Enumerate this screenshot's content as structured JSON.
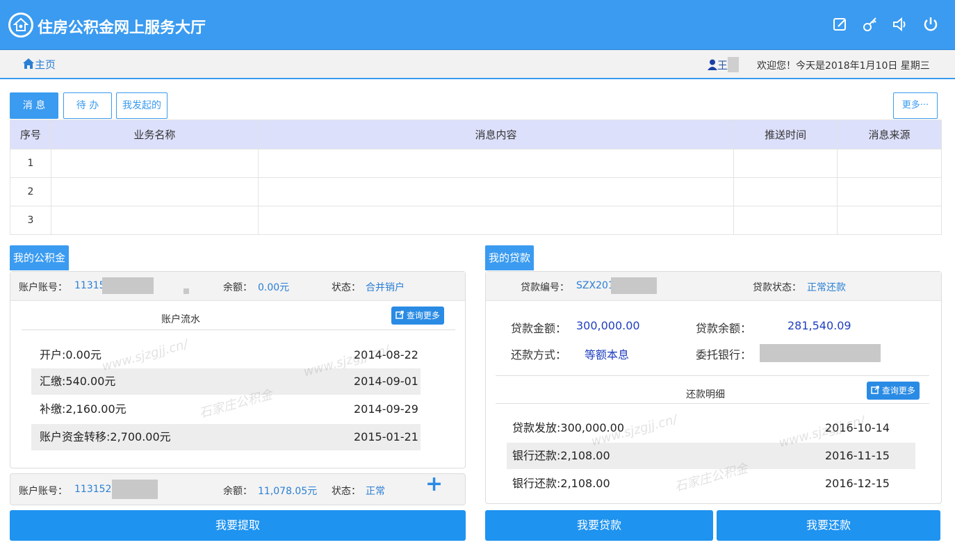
{
  "header": {
    "title": "住房公积金网上服务大厅",
    "icons": [
      "edit-icon",
      "key-icon",
      "speaker-icon",
      "power-icon"
    ]
  },
  "subbar": {
    "home_label": "主页",
    "user_name": "王",
    "welcome": "欢迎您！今天是2018年1月10日 星期三"
  },
  "tabs": [
    {
      "label": "消 息",
      "active": true
    },
    {
      "label": "待 办",
      "active": false
    },
    {
      "label": "我发起的",
      "active": false
    }
  ],
  "more_label": "更多···",
  "table": {
    "headers": [
      "序号",
      "业务名称",
      "消息内容",
      "推送时间",
      "消息来源"
    ],
    "rows": [
      [
        "1",
        "",
        "",
        "",
        ""
      ],
      [
        "2",
        "",
        "",
        "",
        ""
      ],
      [
        "3",
        "",
        "",
        "",
        ""
      ]
    ]
  },
  "fund": {
    "section_label": "我的公积金",
    "account1": {
      "account_label": "账户账号：",
      "account_no": "11315",
      "balance_label": "余额：",
      "balance": "0.00元",
      "status_label": "状态：",
      "status": "合并销户"
    },
    "flow_title": "账户流水",
    "query_more": "查询更多",
    "flows": [
      {
        "desc": "开户:0.00元",
        "date": "2014-08-22"
      },
      {
        "desc": "汇缴:540.00元",
        "date": "2014-09-01"
      },
      {
        "desc": "补缴:2,160.00元",
        "date": "2014-09-29"
      },
      {
        "desc": "账户资金转移:2,700.00元",
        "date": "2015-01-21"
      }
    ],
    "account2": {
      "account_label": "账户账号：",
      "account_no": "113152",
      "balance_label": "余额：",
      "balance": "11,078.05元",
      "status_label": "状态：",
      "status": "正常"
    },
    "withdraw_button": "我要提取"
  },
  "loan": {
    "section_label": "我的贷款",
    "loan_no_label": "贷款编号：",
    "loan_no": "SZX201",
    "loan_status_label": "贷款状态：",
    "loan_status": "正常还款",
    "amount_label": "贷款金额：",
    "amount": "300,000.00",
    "remain_label": "贷款余额：",
    "remain": "281,540.09",
    "method_label": "还款方式：",
    "method": "等额本息",
    "bank_label": "委托银行：",
    "detail_title": "还款明细",
    "query_more": "查询更多",
    "details": [
      {
        "desc": "贷款发放:300,000.00",
        "date": "2016-10-14"
      },
      {
        "desc": "银行还款:2,108.00",
        "date": "2016-11-15"
      },
      {
        "desc": "银行还款:2,108.00",
        "date": "2016-12-15"
      }
    ],
    "loan_button": "我要贷款",
    "repay_button": "我要还款"
  }
}
